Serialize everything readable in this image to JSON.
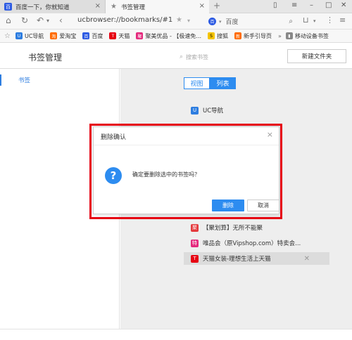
{
  "tabs": [
    {
      "title": "百度一下，你就知道",
      "close": "×"
    },
    {
      "title": "书签管理",
      "close": "×"
    }
  ],
  "new_tab": "+",
  "address": {
    "url": "ucbrowser://bookmarks/#1",
    "search_engine": "百度"
  },
  "bookmarks_bar": [
    {
      "label": "UC导航",
      "color": "#2d7de0",
      "icon": "U"
    },
    {
      "label": "爱淘宝",
      "color": "#ff6a00",
      "icon": "淘"
    },
    {
      "label": "百度",
      "color": "#2d5be3",
      "icon": "百"
    },
    {
      "label": "天猫",
      "color": "#e60012",
      "icon": "T"
    },
    {
      "label": "聚美优品 - 【极速免...",
      "color": "#e4287c",
      "icon": "聚"
    },
    {
      "label": "搜狐",
      "color": "#f5c400",
      "icon": "S"
    },
    {
      "label": "新手引导页",
      "color": "#ff6a00",
      "icon": "新"
    }
  ],
  "bookmarks_more": "»",
  "mobile_bookmarks": "移动设备书签",
  "header": {
    "title": "书签管理",
    "search_placeholder": "搜索书签",
    "new_folder": "新建文件夹"
  },
  "sidebar": {
    "item": "书签"
  },
  "view_toggle": {
    "view": "视图",
    "list": "列表"
  },
  "bookmark_list": [
    {
      "label": "UC导航",
      "color": "#2d7de0",
      "icon": "U"
    },
    {
      "label": "【聚划算】无所不能聚",
      "color": "#e4393c",
      "icon": "聚"
    },
    {
      "label": "唯品会（原Vipshop.com）特卖会...",
      "color": "#e4287c",
      "icon": "特"
    },
    {
      "label": "天猫女装-理想生活上天猫",
      "color": "#e60012",
      "icon": "T",
      "selected": true
    }
  ],
  "dialog": {
    "title": "删除确认",
    "close": "×",
    "message": "确定要删除选中的书签吗？",
    "icon": "?",
    "delete": "删除",
    "cancel": "取消"
  }
}
